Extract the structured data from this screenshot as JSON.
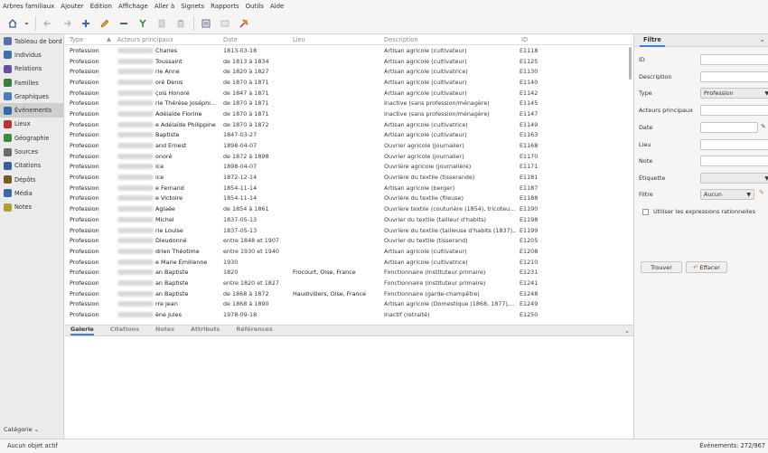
{
  "menubar": {
    "items": [
      "Arbres familiaux",
      "Ajouter",
      "Édition",
      "Affichage",
      "Aller à",
      "Signets",
      "Rapports",
      "Outils",
      "Aide"
    ]
  },
  "toolbar": {
    "icons": [
      "home-tree-icon",
      "dropdown-icon",
      "back-arrow-icon",
      "forward-arrow-icon",
      "add-icon",
      "edit-icon",
      "remove-icon",
      "merge-icon",
      "copy-icon",
      "paste-icon",
      "config-view-icon",
      "sidebar-toggle-icon",
      "tools-icon"
    ]
  },
  "sidebar": {
    "items": [
      {
        "label": "Tableau de bord",
        "icon": "dashboard-icon",
        "color": "#5a6fa8"
      },
      {
        "label": "Individus",
        "icon": "people-icon",
        "color": "#3f6ea8"
      },
      {
        "label": "Relations",
        "icon": "relationships-icon",
        "color": "#6a4fa0"
      },
      {
        "label": "Familles",
        "icon": "families-icon",
        "color": "#3c7c3c"
      },
      {
        "label": "Graphiques",
        "icon": "charts-icon",
        "color": "#4b7bbf"
      },
      {
        "label": "Événements",
        "icon": "events-icon",
        "color": "#2f6aaa"
      },
      {
        "label": "Lieux",
        "icon": "places-icon",
        "color": "#b33"
      },
      {
        "label": "Géographie",
        "icon": "geography-icon",
        "color": "#3a8a3a"
      },
      {
        "label": "Sources",
        "icon": "sources-icon",
        "color": "#6a6a6a"
      },
      {
        "label": "Citations",
        "icon": "citations-icon",
        "color": "#3a5f9a"
      },
      {
        "label": "Dépôts",
        "icon": "repositories-icon",
        "color": "#7a5a2a"
      },
      {
        "label": "Média",
        "icon": "media-icon",
        "color": "#3a6aa0"
      },
      {
        "label": "Notes",
        "icon": "notes-icon",
        "color": "#b0a030"
      }
    ],
    "active_index": 5,
    "category_label": "Catégorie"
  },
  "table": {
    "headers": {
      "type": "Type",
      "actors": "Acteurs principaux",
      "date": "Date",
      "place": "Lieu",
      "description": "Description",
      "id": "ID"
    },
    "rows": [
      {
        "type": "Profession",
        "actors": "Charles",
        "date": "1813-03-18",
        "place": "",
        "description": "Artisan agricole (cultivateur)",
        "id": "E1118"
      },
      {
        "type": "Profession",
        "actors": "Toussaint",
        "date": "de 1813 à 1834",
        "place": "",
        "description": "Artisan agricole (cultivateur)",
        "id": "E1125"
      },
      {
        "type": "Profession",
        "actors": "rie Anne",
        "date": "de 1820 à 1827",
        "place": "",
        "description": "Artisan agricole (cultivatrice)",
        "id": "E1130"
      },
      {
        "type": "Profession",
        "actors": "oré Denis",
        "date": "de 1870 à 1871",
        "place": "",
        "description": "Artisan agricole (cultivateur)",
        "id": "E1140"
      },
      {
        "type": "Profession",
        "actors": "çois Honoré",
        "date": "de 1847 à 1871",
        "place": "",
        "description": "Artisan agricole (cultivateur)",
        "id": "E1142"
      },
      {
        "type": "Profession",
        "actors": "rie Thérèse Joséphi...",
        "date": "de 1870 à 1871",
        "place": "",
        "description": "Inactive (sans profession/ménagère)",
        "id": "E1145"
      },
      {
        "type": "Profession",
        "actors": "Adélaïde Florine",
        "date": "de 1870 à 1871",
        "place": "",
        "description": "Inactive (sans profession/ménagère)",
        "id": "E1147"
      },
      {
        "type": "Profession",
        "actors": "e Adélaïde Philippine",
        "date": "de 1870 à 1872",
        "place": "",
        "description": "Artisan agricole (cultivatrice)",
        "id": "E1149"
      },
      {
        "type": "Profession",
        "actors": "Baptiste",
        "date": "1847-03-27",
        "place": "",
        "description": "Artisan agricole (cultivateur)",
        "id": "E1163"
      },
      {
        "type": "Profession",
        "actors": "and Ernest",
        "date": "1898-04-07",
        "place": "",
        "description": "Ouvrier agricole (journalier)",
        "id": "E1168"
      },
      {
        "type": "Profession",
        "actors": "onoré",
        "date": "de 1872 à 1898",
        "place": "",
        "description": "Ouvrier agricole (journalier)",
        "id": "E1170"
      },
      {
        "type": "Profession",
        "actors": "ice",
        "date": "1898-04-07",
        "place": "",
        "description": "Ouvrière agricole (journalière)",
        "id": "E1171"
      },
      {
        "type": "Profession",
        "actors": "ice",
        "date": "1872-12-14",
        "place": "",
        "description": "Ouvrière du textile (tisserande)",
        "id": "E1181"
      },
      {
        "type": "Profession",
        "actors": "e Fernand",
        "date": "1854-11-14",
        "place": "",
        "description": "Artisan agricole (berger)",
        "id": "E1187"
      },
      {
        "type": "Profession",
        "actors": "e Victoire",
        "date": "1854-11-14",
        "place": "",
        "description": "Ouvrière du textile (fileuse)",
        "id": "E1188"
      },
      {
        "type": "Profession",
        "actors": "Aglaée",
        "date": "de 1854 à 1861",
        "place": "",
        "description": "Ouvrière textile (couturière (1854), tricoteu...",
        "id": "E1190"
      },
      {
        "type": "Profession",
        "actors": "Michel",
        "date": "1837-05-13",
        "place": "",
        "description": "Ouvrier du textile (tailleur d'habits)",
        "id": "E1198"
      },
      {
        "type": "Profession",
        "actors": "rie Louise",
        "date": "1837-05-13",
        "place": "",
        "description": "Ouvrière du textile (tailleuse d'habits (1837),...",
        "id": "E1199"
      },
      {
        "type": "Profession",
        "actors": "Dieudonné",
        "date": "entre 1848 et 1907",
        "place": "",
        "description": "Ouvrier du textile (tisserand)",
        "id": "E1205"
      },
      {
        "type": "Profession",
        "actors": "drien Théotime",
        "date": "entre 1930 et 1940",
        "place": "",
        "description": "Artisan agricole (cultivateur)",
        "id": "E1208"
      },
      {
        "type": "Profession",
        "actors": "e Marie Emilienne",
        "date": "1930",
        "place": "",
        "description": "Artisan agricole (cultivatrice)",
        "id": "E1210"
      },
      {
        "type": "Profession",
        "actors": "an Baptiste",
        "date": "1820",
        "place": "Frocourt, Oise, France",
        "description": "Fonctionnaire (Instituteur primaire)",
        "id": "E1231"
      },
      {
        "type": "Profession",
        "actors": "an Baptiste",
        "date": "entre 1820 et 1827",
        "place": "",
        "description": "Fonctionnaire (Instituteur primaire)",
        "id": "E1241"
      },
      {
        "type": "Profession",
        "actors": "an Baptiste",
        "date": "de 1868 à 1872",
        "place": "Haudivillers, Oise, France",
        "description": "Fonctionnaire (garde-champêtre)",
        "id": "E1248"
      },
      {
        "type": "Profession",
        "actors": "rre Jean",
        "date": "de 1868 à 1890",
        "place": "",
        "description": "Artisan agricole (Domestique (1868, 1877),...",
        "id": "E1249"
      },
      {
        "type": "Profession",
        "actors": "ène Jules",
        "date": "1978-09-18",
        "place": "",
        "description": "Inactif (retraité)",
        "id": "E1250"
      }
    ]
  },
  "bottom_tabs": {
    "items": [
      "Galerie",
      "Citations",
      "Notes",
      "Attributs",
      "Références"
    ],
    "active_index": 0
  },
  "filter": {
    "tab_label": "Filtre",
    "fields": {
      "id_label": "ID",
      "description_label": "Description",
      "type_label": "Type",
      "type_value": "Profession",
      "actors_label": "Acteurs principaux",
      "date_label": "Date",
      "place_label": "Lieu",
      "note_label": "Note",
      "tag_label": "Étiquette",
      "filter_label": "Filtre",
      "filter_value": "Aucun",
      "regex_label": "Utiliser les expressions rationnelles"
    },
    "find_button": "Trouver",
    "clear_button": "Effacer"
  },
  "status": {
    "left": "Aucun objet actif",
    "right": "Événements: 272/967"
  }
}
